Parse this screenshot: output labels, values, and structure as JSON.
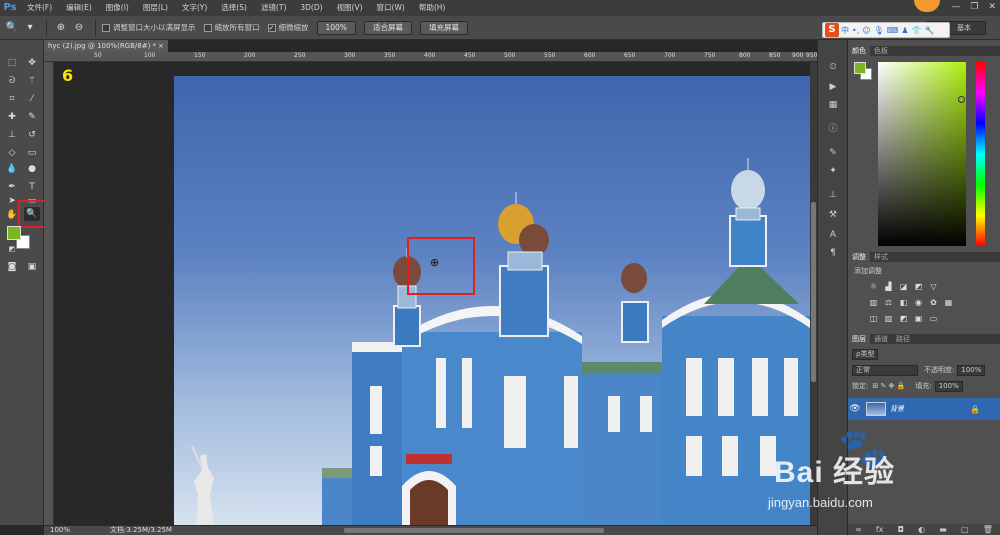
{
  "app": {
    "logo": "Ps"
  },
  "menu": [
    "文件(F)",
    "编辑(E)",
    "图像(I)",
    "图层(L)",
    "文字(Y)",
    "选择(S)",
    "滤镜(T)",
    "3D(D)",
    "视图(V)",
    "窗口(W)",
    "帮助(H)"
  ],
  "window_controls": {
    "minimize": "—",
    "restore": "❐",
    "close": "✕"
  },
  "options": {
    "resize_windows_label": "调整窗口大小以满屏显示",
    "resize_windows_checked": false,
    "zoom_all_label": "缩放所有窗口",
    "zoom_all_checked": false,
    "scrubby_zoom_label": "细微缩放",
    "scrubby_zoom_checked": true,
    "btn_100": "100%",
    "btn_fit": "适合屏幕",
    "btn_fill": "填充屏幕",
    "workspace": "基本"
  },
  "ime": {
    "logo": "S",
    "lang": "中"
  },
  "document": {
    "tab_title": "hyc (2).jpg @ 100%(RGB/8#) *",
    "tab_close": "×",
    "ruler_ticks": [
      "50",
      "100",
      "150",
      "200",
      "250",
      "300",
      "350",
      "400",
      "450",
      "500",
      "550",
      "600",
      "650",
      "700",
      "750",
      "800",
      "850",
      "900",
      "950"
    ],
    "step_number": "6"
  },
  "status": {
    "zoom": "100%",
    "doc_size": "文档:3.25M/3.25M"
  },
  "panels": {
    "color_tabs": [
      "颜色",
      "色板"
    ],
    "adjust_tabs": [
      "调整",
      "样式"
    ],
    "adjust_label": "添加调整",
    "layers_tabs": [
      "图层",
      "通道",
      "路径"
    ],
    "kind_label": "ρ类型",
    "blend_mode": "正常",
    "opacity_label": "不透明度:",
    "opacity_value": "100%",
    "lock_label": "锁定:",
    "fill_label": "填充:",
    "fill_value": "100%",
    "layer_name": "背景"
  },
  "colors": {
    "foreground": "#7bb51f",
    "background": "#ffffff",
    "highlight": "#e02020"
  },
  "watermark": {
    "brand": "Bai  经验",
    "url": "jingyan.baidu.com"
  }
}
